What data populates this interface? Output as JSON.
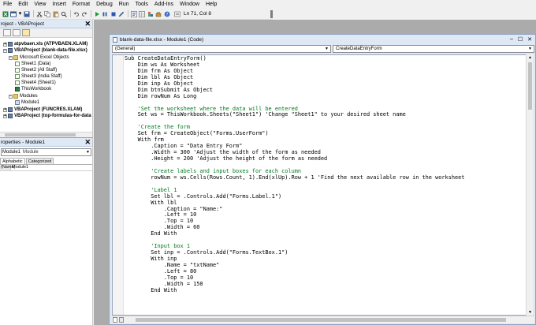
{
  "menu": [
    "File",
    "Edit",
    "View",
    "Insert",
    "Format",
    "Debug",
    "Run",
    "Tools",
    "Add-Ins",
    "Window",
    "Help"
  ],
  "toolbar": {
    "cursor_position": "Ln 71, Col 8"
  },
  "project_pane": {
    "title": "roject - VBAProject",
    "close": "✕",
    "tree": [
      {
        "label": "atpvbaen.xls (ATPVBAEN.XLAM)",
        "icon": "vba-project-icon",
        "bold": true,
        "expander": "+"
      },
      {
        "label": "VBAProject (blank-data-file.xlsx)",
        "icon": "vba-project-icon",
        "bold": true,
        "expander": "−"
      },
      {
        "label": "Microsoft Excel Objects",
        "icon": "folder-icon",
        "bold": false,
        "expander": "−"
      },
      {
        "label": "Sheet1 (Data)",
        "icon": "worksheet-icon",
        "bold": false,
        "expander": ""
      },
      {
        "label": "Sheet2 (All Staff)",
        "icon": "worksheet-icon",
        "bold": false,
        "expander": ""
      },
      {
        "label": "Sheet3 (India Staff)",
        "icon": "worksheet-icon",
        "bold": false,
        "expander": ""
      },
      {
        "label": "Sheet4 (Sheet1)",
        "icon": "worksheet-icon",
        "bold": false,
        "expander": ""
      },
      {
        "label": "ThisWorkbook",
        "icon": "workbook-icon",
        "bold": false,
        "expander": ""
      },
      {
        "label": "Modules",
        "icon": "folder-icon",
        "bold": false,
        "expander": "−"
      },
      {
        "label": "Module1",
        "icon": "module-icon",
        "bold": false,
        "expander": ""
      },
      {
        "label": "VBAProject (FUNCRES.XLAM)",
        "icon": "vba-project-icon",
        "bold": true,
        "expander": "+"
      },
      {
        "label": "VBAProject (top-formulas-for-data",
        "icon": "vba-project-icon",
        "bold": true,
        "expander": "+"
      }
    ]
  },
  "properties_pane": {
    "title": "roperties - Module1",
    "close": "✕",
    "object_name": "Module1",
    "object_type": "Module",
    "tabs": [
      "Alphabetic",
      "Categorized"
    ],
    "property": {
      "name": "(Name)",
      "value": "Module1"
    }
  },
  "code_window": {
    "title": "blank-data-file.xlsx - Module1 (Code)",
    "object_combo": "(General)",
    "procedure_combo": "CreateDataEntryForm",
    "lines": [
      {
        "text": "Sub CreateDataEntryForm()",
        "comment": false
      },
      {
        "text": "    Dim ws As Worksheet",
        "comment": false
      },
      {
        "text": "    Dim frm As Object",
        "comment": false
      },
      {
        "text": "    Dim lbl As Object",
        "comment": false
      },
      {
        "text": "    Dim inp As Object",
        "comment": false
      },
      {
        "text": "    Dim btnSubmit As Object",
        "comment": false
      },
      {
        "text": "    Dim rowNum As Long",
        "comment": false
      },
      {
        "text": "",
        "comment": false
      },
      {
        "text": "    'Set the worksheet where the data will be entered",
        "comment": true
      },
      {
        "text": "    Set ws = ThisWorkbook.Sheets(\"Sheet1\") 'Change \"Sheet1\" to your desired sheet name",
        "comment": false
      },
      {
        "text": "",
        "comment": false
      },
      {
        "text": "    'Create the form",
        "comment": true
      },
      {
        "text": "    Set frm = CreateObject(\"Forms.UserForm\")",
        "comment": false
      },
      {
        "text": "    With frm",
        "comment": false
      },
      {
        "text": "        .Caption = \"Data Entry Form\"",
        "comment": false
      },
      {
        "text": "        .Width = 300 'Adjust the width of the form as needed",
        "comment": false
      },
      {
        "text": "        .Height = 200 'Adjust the height of the form as needed",
        "comment": false
      },
      {
        "text": "",
        "comment": false
      },
      {
        "text": "        'Create labels and input boxes for each column",
        "comment": true
      },
      {
        "text": "        rowNum = ws.Cells(Rows.Count, 1).End(xlUp).Row + 1 'Find the next available row in the worksheet",
        "comment": false
      },
      {
        "text": "",
        "comment": false
      },
      {
        "text": "        'Label 1",
        "comment": true
      },
      {
        "text": "        Set lbl = .Controls.Add(\"Forms.Label.1\")",
        "comment": false
      },
      {
        "text": "        With lbl",
        "comment": false
      },
      {
        "text": "            .Caption = \"Name:\"",
        "comment": false
      },
      {
        "text": "            .Left = 10",
        "comment": false
      },
      {
        "text": "            .Top = 10",
        "comment": false
      },
      {
        "text": "            .Width = 60",
        "comment": false
      },
      {
        "text": "        End With",
        "comment": false
      },
      {
        "text": "",
        "comment": false
      },
      {
        "text": "        'Input box 1",
        "comment": true
      },
      {
        "text": "        Set inp = .Controls.Add(\"Forms.TextBox.1\")",
        "comment": false
      },
      {
        "text": "        With inp",
        "comment": false
      },
      {
        "text": "            .Name = \"txtName\"",
        "comment": false
      },
      {
        "text": "            .Left = 80",
        "comment": false
      },
      {
        "text": "            .Top = 10",
        "comment": false
      },
      {
        "text": "            .Width = 150",
        "comment": false
      },
      {
        "text": "        End With",
        "comment": false
      }
    ]
  },
  "colors": {
    "comment": "#007a1e",
    "pane_title_bg": "#dfe8f5",
    "mdi_bg": "#ababab"
  }
}
